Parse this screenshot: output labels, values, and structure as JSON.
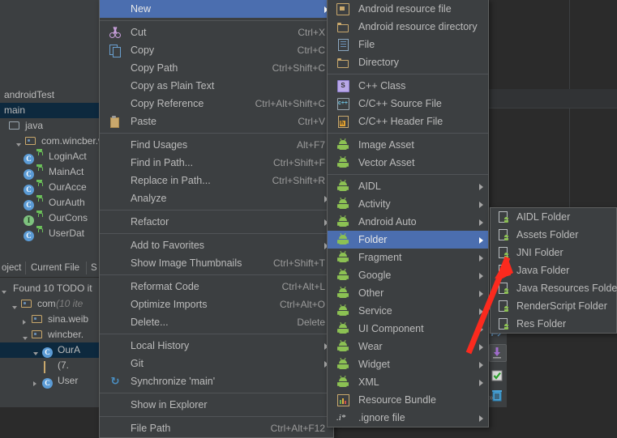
{
  "app": {
    "theme_bg": "#2b2b2b",
    "panel_bg": "#3c3f41",
    "accent_selection": "#4b6eaf",
    "tree_selection": "#0d293e",
    "text_color": "#bbbbbb",
    "annotation_color": "#fb2a1e"
  },
  "project_tree": {
    "rows": [
      {
        "label": "androidTest",
        "indent": 0,
        "selected": false,
        "icons": []
      },
      {
        "label": "main",
        "indent": 0,
        "selected": true,
        "icons": []
      },
      {
        "label": "java",
        "indent": 1,
        "selected": false,
        "icons": [
          "folder-icon"
        ]
      },
      {
        "label": "com.wincber.w",
        "indent": 2,
        "selected": false,
        "icons": [
          "expand-down-icon",
          "package-folder-icon"
        ]
      },
      {
        "label": "LoginAct",
        "indent": 3,
        "selected": false,
        "icons": [
          "class-icon",
          "lock-icon"
        ]
      },
      {
        "label": "MainAct",
        "indent": 3,
        "selected": false,
        "icons": [
          "class-icon",
          "lock-icon"
        ]
      },
      {
        "label": "OurAcce",
        "indent": 3,
        "selected": false,
        "icons": [
          "class-icon",
          "lock-icon"
        ]
      },
      {
        "label": "OurAuth",
        "indent": 3,
        "selected": false,
        "icons": [
          "class-icon",
          "lock-icon"
        ]
      },
      {
        "label": "OurCons",
        "indent": 3,
        "selected": false,
        "icons": [
          "interface-icon",
          "lock-icon"
        ]
      },
      {
        "label": "UserDat",
        "indent": 3,
        "selected": false,
        "icons": [
          "class-icon",
          "lock-icon"
        ]
      }
    ]
  },
  "todo_panel": {
    "tabs": [
      {
        "label": "oject"
      },
      {
        "label": "Current File"
      },
      {
        "label": "S"
      }
    ],
    "rows": [
      {
        "label": "Found 10 TODO it",
        "note": "",
        "indent": 0,
        "selected": false,
        "icons": [
          "expand-down-icon"
        ]
      },
      {
        "label": "com",
        "note": "(10 ite",
        "indent": 1,
        "selected": false,
        "icons": [
          "expand-down-icon",
          "package-folder-icon"
        ]
      },
      {
        "label": "sina.weib",
        "note": "",
        "indent": 2,
        "selected": false,
        "icons": [
          "expand-right-icon",
          "package-folder-icon"
        ]
      },
      {
        "label": "wincber.",
        "note": "",
        "indent": 2,
        "selected": false,
        "icons": [
          "expand-down-icon",
          "package-folder-icon"
        ]
      },
      {
        "label": "OurA",
        "note": "",
        "indent": 3,
        "selected": true,
        "icons": [
          "expand-down-icon",
          "class-icon"
        ]
      },
      {
        "label": "(7.",
        "note": "",
        "indent": 4,
        "selected": false,
        "icons": [
          "document-icon"
        ]
      },
      {
        "label": "User",
        "note": "",
        "indent": 3,
        "selected": false,
        "icons": [
          "expand-right-icon",
          "class-icon"
        ]
      }
    ]
  },
  "right_toolstrip": {
    "buttons": [
      {
        "name": "commit-icon"
      },
      {
        "name": "update-project-icon"
      },
      {
        "name": "checkmark-icon"
      },
      {
        "name": "trash-icon"
      }
    ],
    "overflow_label": "»"
  },
  "context_menu": {
    "name": "editor-context-menu",
    "items": [
      {
        "type": "item",
        "label": "New",
        "mnemonic": "N",
        "accel": "",
        "icon": "",
        "submenu": true,
        "selected": true
      },
      {
        "type": "sep"
      },
      {
        "type": "item",
        "label": "Cut",
        "mnemonic": "t",
        "accel": "Ctrl+X",
        "icon": "scissors-icon",
        "submenu": false,
        "selected": false
      },
      {
        "type": "item",
        "label": "Copy",
        "mnemonic": "C",
        "accel": "Ctrl+C",
        "icon": "copy-icon",
        "submenu": false,
        "selected": false
      },
      {
        "type": "item",
        "label": "Copy Path",
        "mnemonic": "o",
        "accel": "Ctrl+Shift+C",
        "icon": "",
        "submenu": false,
        "selected": false
      },
      {
        "type": "item",
        "label": "Copy as Plain Text",
        "mnemonic": "",
        "accel": "",
        "icon": "",
        "submenu": false,
        "selected": false
      },
      {
        "type": "item",
        "label": "Copy Reference",
        "mnemonic": "y",
        "accel": "Ctrl+Alt+Shift+C",
        "icon": "",
        "submenu": false,
        "selected": false
      },
      {
        "type": "item",
        "label": "Paste",
        "mnemonic": "P",
        "accel": "Ctrl+V",
        "icon": "paste-icon",
        "submenu": false,
        "selected": false
      },
      {
        "type": "sep"
      },
      {
        "type": "item",
        "label": "Find Usages",
        "mnemonic": "U",
        "accel": "Alt+F7",
        "icon": "",
        "submenu": false,
        "selected": false
      },
      {
        "type": "item",
        "label": "Find in Path...",
        "mnemonic": "P",
        "accel": "Ctrl+Shift+F",
        "icon": "",
        "submenu": false,
        "selected": false
      },
      {
        "type": "item",
        "label": "Replace in Path...",
        "mnemonic": "l",
        "accel": "Ctrl+Shift+R",
        "icon": "",
        "submenu": false,
        "selected": false
      },
      {
        "type": "item",
        "label": "Analyze",
        "mnemonic": "z",
        "accel": "",
        "icon": "",
        "submenu": true,
        "selected": false
      },
      {
        "type": "sep"
      },
      {
        "type": "item",
        "label": "Refactor",
        "mnemonic": "R",
        "accel": "",
        "icon": "",
        "submenu": true,
        "selected": false
      },
      {
        "type": "sep"
      },
      {
        "type": "item",
        "label": "Add to Favorites",
        "mnemonic": "v",
        "accel": "",
        "icon": "",
        "submenu": true,
        "selected": false
      },
      {
        "type": "item",
        "label": "Show Image Thumbnails",
        "mnemonic": "",
        "accel": "Ctrl+Shift+T",
        "icon": "",
        "submenu": false,
        "selected": false
      },
      {
        "type": "sep"
      },
      {
        "type": "item",
        "label": "Reformat Code",
        "mnemonic": "R",
        "accel": "Ctrl+Alt+L",
        "icon": "",
        "submenu": false,
        "selected": false
      },
      {
        "type": "item",
        "label": "Optimize Imports",
        "mnemonic": "z",
        "accel": "Ctrl+Alt+O",
        "icon": "",
        "submenu": false,
        "selected": false
      },
      {
        "type": "item",
        "label": "Delete...",
        "mnemonic": "D",
        "accel": "Delete",
        "icon": "",
        "submenu": false,
        "selected": false
      },
      {
        "type": "sep"
      },
      {
        "type": "item",
        "label": "Local History",
        "mnemonic": "H",
        "accel": "",
        "icon": "",
        "submenu": true,
        "selected": false
      },
      {
        "type": "item",
        "label": "Git",
        "mnemonic": "G",
        "accel": "",
        "icon": "",
        "submenu": true,
        "selected": false
      },
      {
        "type": "item",
        "label": "Synchronize 'main'",
        "mnemonic": "",
        "accel": "",
        "icon": "sync-icon",
        "submenu": false,
        "selected": false
      },
      {
        "type": "sep"
      },
      {
        "type": "item",
        "label": "Show in Explorer",
        "mnemonic": "",
        "accel": "",
        "icon": "",
        "submenu": false,
        "selected": false
      },
      {
        "type": "sep"
      },
      {
        "type": "item",
        "label": "File Path",
        "mnemonic": "P",
        "accel": "Ctrl+Alt+F12",
        "icon": "",
        "submenu": false,
        "selected": false
      }
    ]
  },
  "new_submenu": {
    "name": "new-submenu",
    "items": [
      {
        "type": "item",
        "label": "Android resource file",
        "accel": "",
        "icon": "android-resource-file-icon",
        "submenu": false,
        "selected": false
      },
      {
        "type": "item",
        "label": "Android resource directory",
        "accel": "",
        "icon": "folder-icon",
        "submenu": false,
        "selected": false
      },
      {
        "type": "item",
        "label": "File",
        "accel": "",
        "icon": "file-icon",
        "submenu": false,
        "selected": false
      },
      {
        "type": "item",
        "label": "Directory",
        "accel": "",
        "icon": "folder-icon",
        "submenu": false,
        "selected": false
      },
      {
        "type": "sep"
      },
      {
        "type": "item",
        "label": "C++ Class",
        "accel": "",
        "icon": "cpp-class-icon",
        "submenu": false,
        "selected": false
      },
      {
        "type": "item",
        "label": "C/C++ Source File",
        "accel": "",
        "icon": "cpp-source-icon",
        "submenu": false,
        "selected": false
      },
      {
        "type": "item",
        "label": "C/C++ Header File",
        "accel": "",
        "icon": "cpp-header-icon",
        "submenu": false,
        "selected": false
      },
      {
        "type": "sep"
      },
      {
        "type": "item",
        "label": "Image Asset",
        "accel": "",
        "icon": "android-icon",
        "submenu": false,
        "selected": false
      },
      {
        "type": "item",
        "label": "Vector Asset",
        "accel": "",
        "icon": "android-icon",
        "submenu": false,
        "selected": false
      },
      {
        "type": "sep"
      },
      {
        "type": "item",
        "label": "AIDL",
        "accel": "",
        "icon": "android-icon",
        "submenu": true,
        "selected": false
      },
      {
        "type": "item",
        "label": "Activity",
        "accel": "",
        "icon": "android-icon",
        "submenu": true,
        "selected": false
      },
      {
        "type": "item",
        "label": "Android Auto",
        "accel": "",
        "icon": "android-icon",
        "submenu": true,
        "selected": false
      },
      {
        "type": "item",
        "label": "Folder",
        "accel": "",
        "icon": "android-icon",
        "submenu": true,
        "selected": true
      },
      {
        "type": "item",
        "label": "Fragment",
        "accel": "",
        "icon": "android-icon",
        "submenu": true,
        "selected": false
      },
      {
        "type": "item",
        "label": "Google",
        "accel": "",
        "icon": "android-icon",
        "submenu": true,
        "selected": false
      },
      {
        "type": "item",
        "label": "Other",
        "accel": "",
        "icon": "android-icon",
        "submenu": true,
        "selected": false
      },
      {
        "type": "item",
        "label": "Service",
        "accel": "",
        "icon": "android-icon",
        "submenu": true,
        "selected": false
      },
      {
        "type": "item",
        "label": "UI Component",
        "accel": "",
        "icon": "android-icon",
        "submenu": true,
        "selected": false
      },
      {
        "type": "item",
        "label": "Wear",
        "accel": "",
        "icon": "android-icon",
        "submenu": true,
        "selected": false
      },
      {
        "type": "item",
        "label": "Widget",
        "accel": "",
        "icon": "android-icon",
        "submenu": true,
        "selected": false
      },
      {
        "type": "item",
        "label": "XML",
        "accel": "",
        "icon": "android-icon",
        "submenu": true,
        "selected": false
      },
      {
        "type": "item",
        "label": "Resource Bundle",
        "accel": "",
        "icon": "resource-bundle-icon",
        "submenu": false,
        "selected": false
      },
      {
        "type": "item",
        "label": ".ignore file",
        "accel": "",
        "icon": "ignore-file-icon",
        "submenu": true,
        "selected": false
      }
    ]
  },
  "folder_submenu": {
    "name": "folder-submenu",
    "items": [
      {
        "label": "AIDL Folder",
        "icon": "droid-folder-icon"
      },
      {
        "label": "Assets Folder",
        "icon": "droid-folder-icon"
      },
      {
        "label": "JNI Folder",
        "icon": "droid-folder-icon"
      },
      {
        "label": "Java Folder",
        "icon": "droid-folder-icon"
      },
      {
        "label": "Java Resources Folder",
        "icon": "droid-folder-icon"
      },
      {
        "label": "RenderScript Folder",
        "icon": "droid-folder-icon"
      },
      {
        "label": "Res Folder",
        "icon": "droid-folder-icon"
      }
    ]
  },
  "annotation": {
    "type": "red-arrow",
    "points_to": "JNI Folder",
    "color": "#fb2a1e"
  }
}
